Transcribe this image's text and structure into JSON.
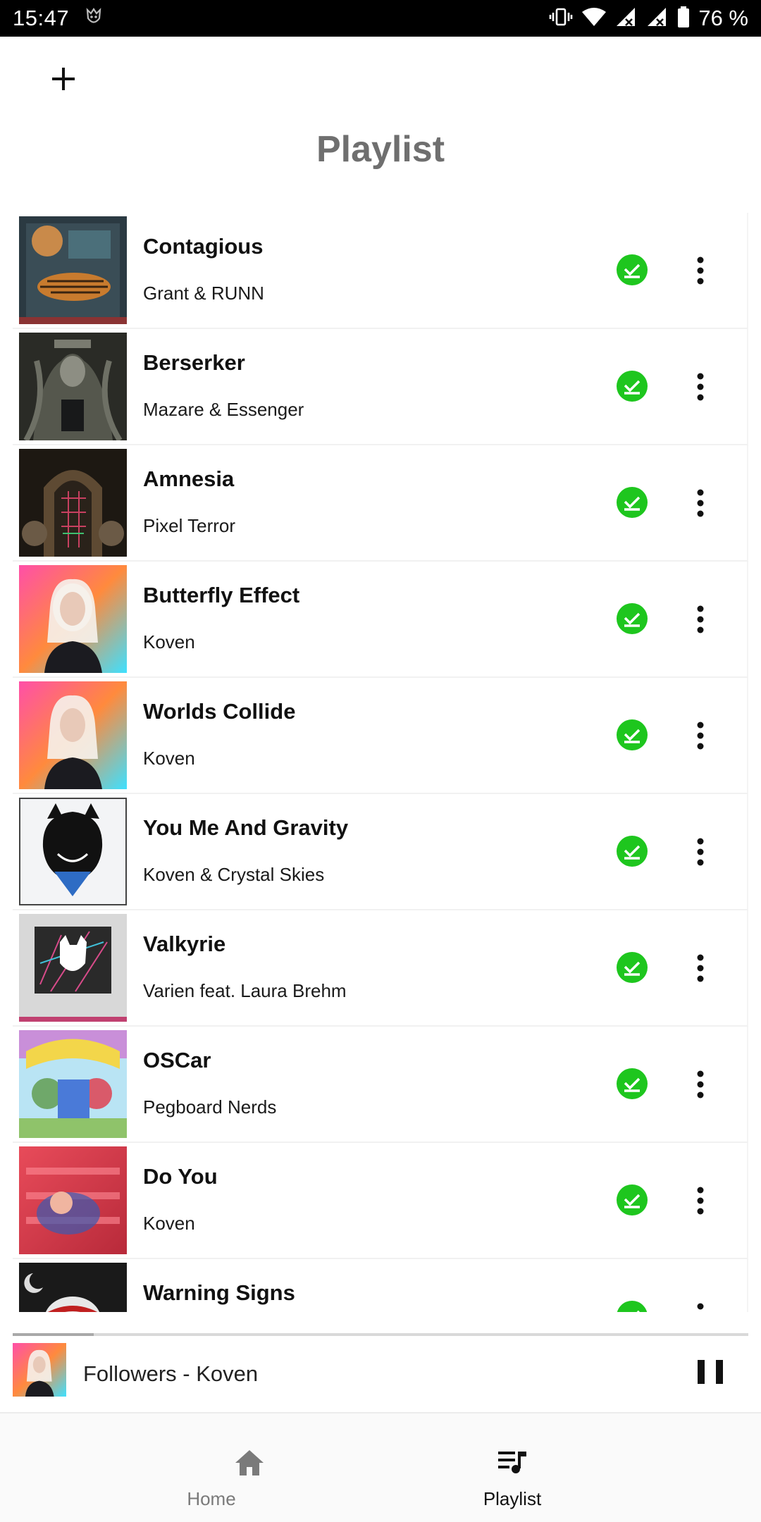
{
  "status_bar": {
    "time": "15:47",
    "battery": "76 %",
    "icons": [
      "app-notification-icon",
      "vibrate-icon",
      "wifi-icon",
      "signal-icon",
      "signal-icon",
      "battery-icon"
    ]
  },
  "header": {
    "add_icon": "plus-icon",
    "title": "Playlist"
  },
  "playlist": {
    "download_color": "#1ec61e",
    "tracks": [
      {
        "title": "Contagious",
        "artist": "Grant & RUNN"
      },
      {
        "title": "Berserker",
        "artist": "Mazare & Essenger"
      },
      {
        "title": "Amnesia",
        "artist": "Pixel Terror"
      },
      {
        "title": "Butterfly Effect",
        "artist": "Koven"
      },
      {
        "title": "Worlds Collide",
        "artist": "Koven"
      },
      {
        "title": "You Me And Gravity",
        "artist": "Koven & Crystal Skies"
      },
      {
        "title": "Valkyrie",
        "artist": "Varien feat. Laura Brehm"
      },
      {
        "title": "OSCar",
        "artist": "Pegboard Nerds"
      },
      {
        "title": "Do You",
        "artist": "Koven"
      },
      {
        "title": "Warning Signs",
        "artist": ""
      }
    ]
  },
  "now_playing": {
    "title": "Followers",
    "separator": " - ",
    "artist": "Koven",
    "progress": 0.11
  },
  "bottom_nav": {
    "home_label": "Home",
    "playlist_label": "Playlist",
    "active": "playlist",
    "active_color": "#111111",
    "inactive_color": "#7a7a7a"
  }
}
